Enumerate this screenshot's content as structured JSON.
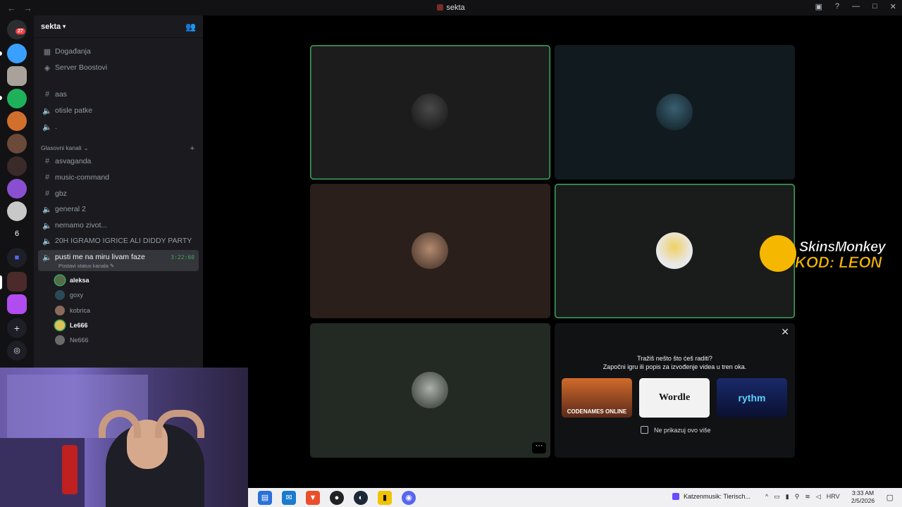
{
  "window": {
    "title": "sekta"
  },
  "rail": {
    "dm_badge": "27",
    "numbered_server": "6"
  },
  "server": {
    "name": "sekta"
  },
  "sidebar": {
    "top_items": [
      {
        "label": "Događanja",
        "icon": "calendar-icon"
      },
      {
        "label": "Server Boostovi",
        "icon": "boost-icon"
      }
    ],
    "channels": [
      {
        "label": "aas",
        "icon": "hash-icon"
      },
      {
        "label": "otisle patke",
        "icon": "speaker-icon"
      },
      {
        "label": ".",
        "icon": "speaker-icon"
      }
    ],
    "category": "Glasovni kanali",
    "voice_channels": [
      {
        "label": "asvaganda",
        "icon": "hash-icon"
      },
      {
        "label": "music-command",
        "icon": "hash-icon"
      },
      {
        "label": "gbz",
        "icon": "hash-icon"
      },
      {
        "label": "general 2",
        "icon": "speaker-icon"
      },
      {
        "label": "nemamo zivot...",
        "icon": "speaker-icon"
      },
      {
        "label": "20H IGRAMO IGRICE ALI DIDDY PARTY",
        "icon": "speaker-icon"
      }
    ],
    "active_channel": {
      "label": "pusti me na miru livam faze",
      "status": "Postavi status kanala",
      "timer": "3:22:60"
    },
    "voice_users": [
      {
        "name": "aleksa",
        "speaking": true
      },
      {
        "name": "goxy",
        "speaking": false
      },
      {
        "name": "kobrica",
        "speaking": false
      },
      {
        "name": "Le666",
        "speaking": true
      },
      {
        "name": "Ne666",
        "speaking": false
      }
    ]
  },
  "activity_prompt": {
    "line1": "Tražiš nešto što ćeš raditi?",
    "line2": "Započni igru ili popis za izvođenje videa u tren oka.",
    "cards": [
      "CODENAMES ONLINE",
      "Wordle",
      "rythm"
    ],
    "checkbox_label": "Ne prikazuj ovo više"
  },
  "overlay": {
    "line1": "SkinsMonkey",
    "line2": "KOD: LEON"
  },
  "taskbar": {
    "media": "Katzenmusik: Tierisch...",
    "lang": "HRV",
    "time": "3:33 AM",
    "date": "2/5/2026"
  },
  "colors": {
    "speaking": "#3ba55d",
    "accent": "#5865f2"
  }
}
